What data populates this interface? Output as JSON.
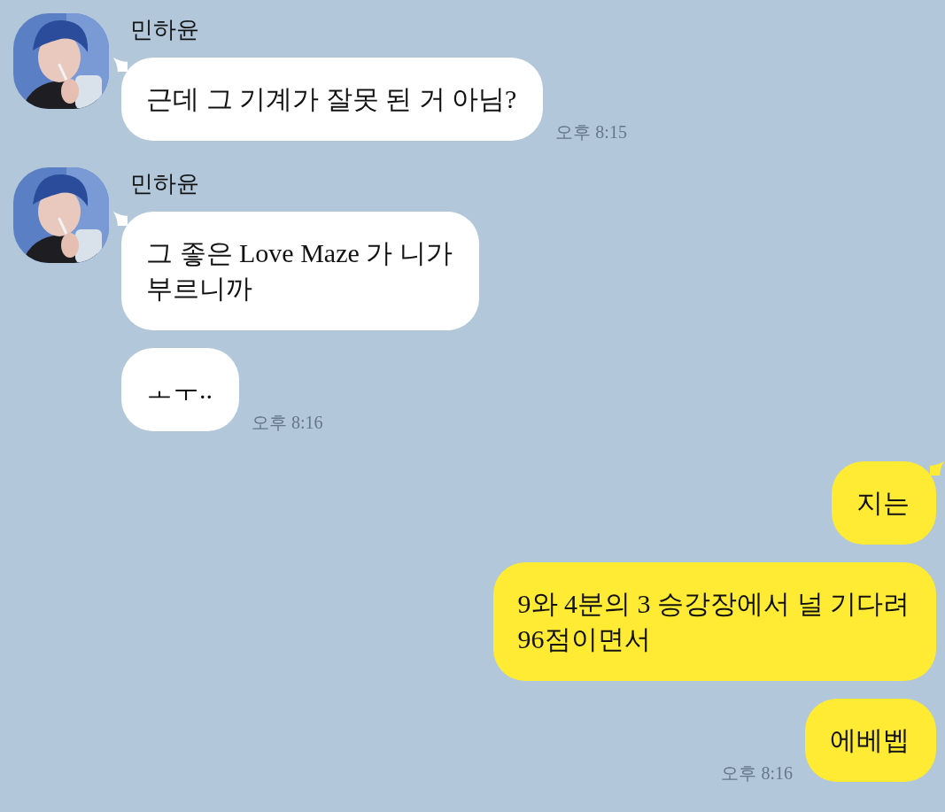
{
  "groups": [
    {
      "kind": "received",
      "name": "민하윤",
      "avatar": {
        "kind": "picture"
      },
      "messages": [
        {
          "lines": [
            "근데 그 기계가 잘못 된 거 아님?"
          ],
          "time": "오후 8:15"
        }
      ]
    },
    {
      "kind": "received",
      "name": "민하윤",
      "avatar": {
        "kind": "picture"
      },
      "messages": [
        {
          "lines": [
            "그 좋은 Love Maze 가 니가",
            "부르니까"
          ]
        },
        {
          "lines": [
            "ㅗㅜ.."
          ],
          "time": "오후 8:16"
        }
      ]
    },
    {
      "kind": "sent",
      "messages": [
        {
          "lines": [
            "지는"
          ]
        },
        {
          "lines": [
            "9와 4분의 3 승강장에서 널 기다려",
            "96점이면서"
          ]
        },
        {
          "lines": [
            "에베벱"
          ],
          "time": "오후 8:16"
        }
      ]
    }
  ]
}
